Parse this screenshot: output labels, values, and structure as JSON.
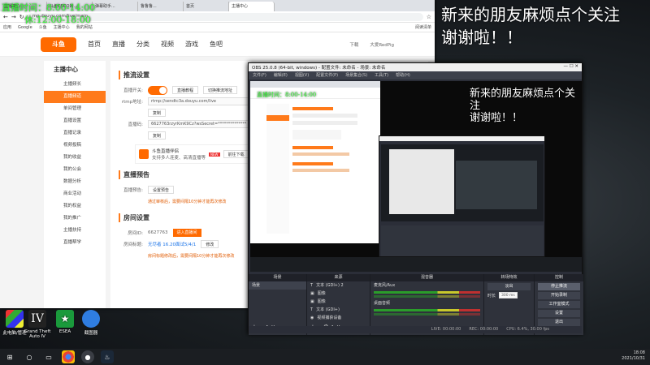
{
  "overlay": {
    "live_time": "直播时间：8:00-14:00",
    "rest_time": "休:12:00-18:00",
    "follow_banner_line1": "新来的朋友麻烦点个关注",
    "follow_banner_line2": "谢谢啦！！"
  },
  "browser": {
    "tabs": [
      "主播中心",
      "斗鱼CSGO的...",
      "弹幕助手...",
      "鲁鲁鲁...",
      "首页",
      "主播中心"
    ],
    "url": "mp.douyu.com/live/main",
    "bookmarks": [
      "应用",
      "Google",
      "斗鱼",
      "主播中心",
      "我的网站",
      "阅读清单"
    ]
  },
  "douyu": {
    "logo": "斗鱼",
    "nav": [
      "首页",
      "直播",
      "分类",
      "视频",
      "游戏",
      "鱼吧"
    ],
    "download": "下载",
    "user": "大爱RedPig",
    "sidebar_title": "主播中心",
    "sidebar": [
      "主播频长",
      "直播频道",
      "单间管理",
      "直播设置",
      "直播记录",
      "视频投稿",
      "我的收益",
      "我的公会",
      "数据分析",
      "商业活动",
      "我的权益",
      "我的推广",
      "主播扶持",
      "直播帮学"
    ],
    "section1": "推流设置",
    "stream_switch_label": "直播开关:",
    "tutorial_btn": "直播教程",
    "switch_btn": "切换推流地址",
    "rtmp_label": "rtmp地址:",
    "rtmp_value": "rtmp://sendtc3a.douyu.com/live",
    "copy": "复制",
    "key_label": "直播码:",
    "key_value": "6627763rzyrKmK9Cz?wsSecret=**************",
    "tool_title": "斗鱼直播伴侣",
    "tool_desc": "支持多人连麦、高清直播等",
    "tool_btn": "前往下载",
    "new_badge": "NEW",
    "section2": "直播预告",
    "preview_label": "直播预告:",
    "preview_btn": "设置预告",
    "preview_warn": "通过审核后，需要间隔10分钟才能再次修改",
    "section3": "房间设置",
    "room_label": "房间ID:",
    "room_id": "6627763",
    "room_btn": "进入直播间",
    "room_title_label": "房间标题:",
    "room_title": "无尽者 16.20面试5/4/1",
    "edit_btn": "修改",
    "room_warn": "房间标题修改后，需要间隔10分钟才能再次修改"
  },
  "obs": {
    "title": "OBS 25.0.8 (64-bit, windows) - 配置文件: 未命名 - 场景: 未命名",
    "menu": [
      "文件(F)",
      "编辑(E)",
      "视图(V)",
      "配置文件(P)",
      "场景集合(S)",
      "工具(T)",
      "帮助(H)"
    ],
    "docks": [
      "场景",
      "来源",
      "混音器",
      "转场特效",
      "控制"
    ],
    "scene": "场景",
    "sources": [
      "文本 (GDI+) 2",
      "图像",
      "图像",
      "文本 (GDI+)",
      "视频捕获设备"
    ],
    "mixer": [
      "麦克风/Aux",
      "桌面音频"
    ],
    "transition": "淡出",
    "duration_label": "时长",
    "duration": "300 ms",
    "controls": [
      "停止推流",
      "开始录制",
      "工作室模式",
      "设置",
      "退出"
    ],
    "status": [
      "LIVE: 00:00:00",
      "REC: 00:00:00",
      "CPU: 6.4%, 30.00 fps"
    ]
  },
  "desktop_icons": [
    "此电脑/管理",
    "Grand Theft Auto IV",
    "ESEA",
    "截图器"
  ],
  "tray": {
    "time": "18:08",
    "date": "2021/10/31"
  }
}
